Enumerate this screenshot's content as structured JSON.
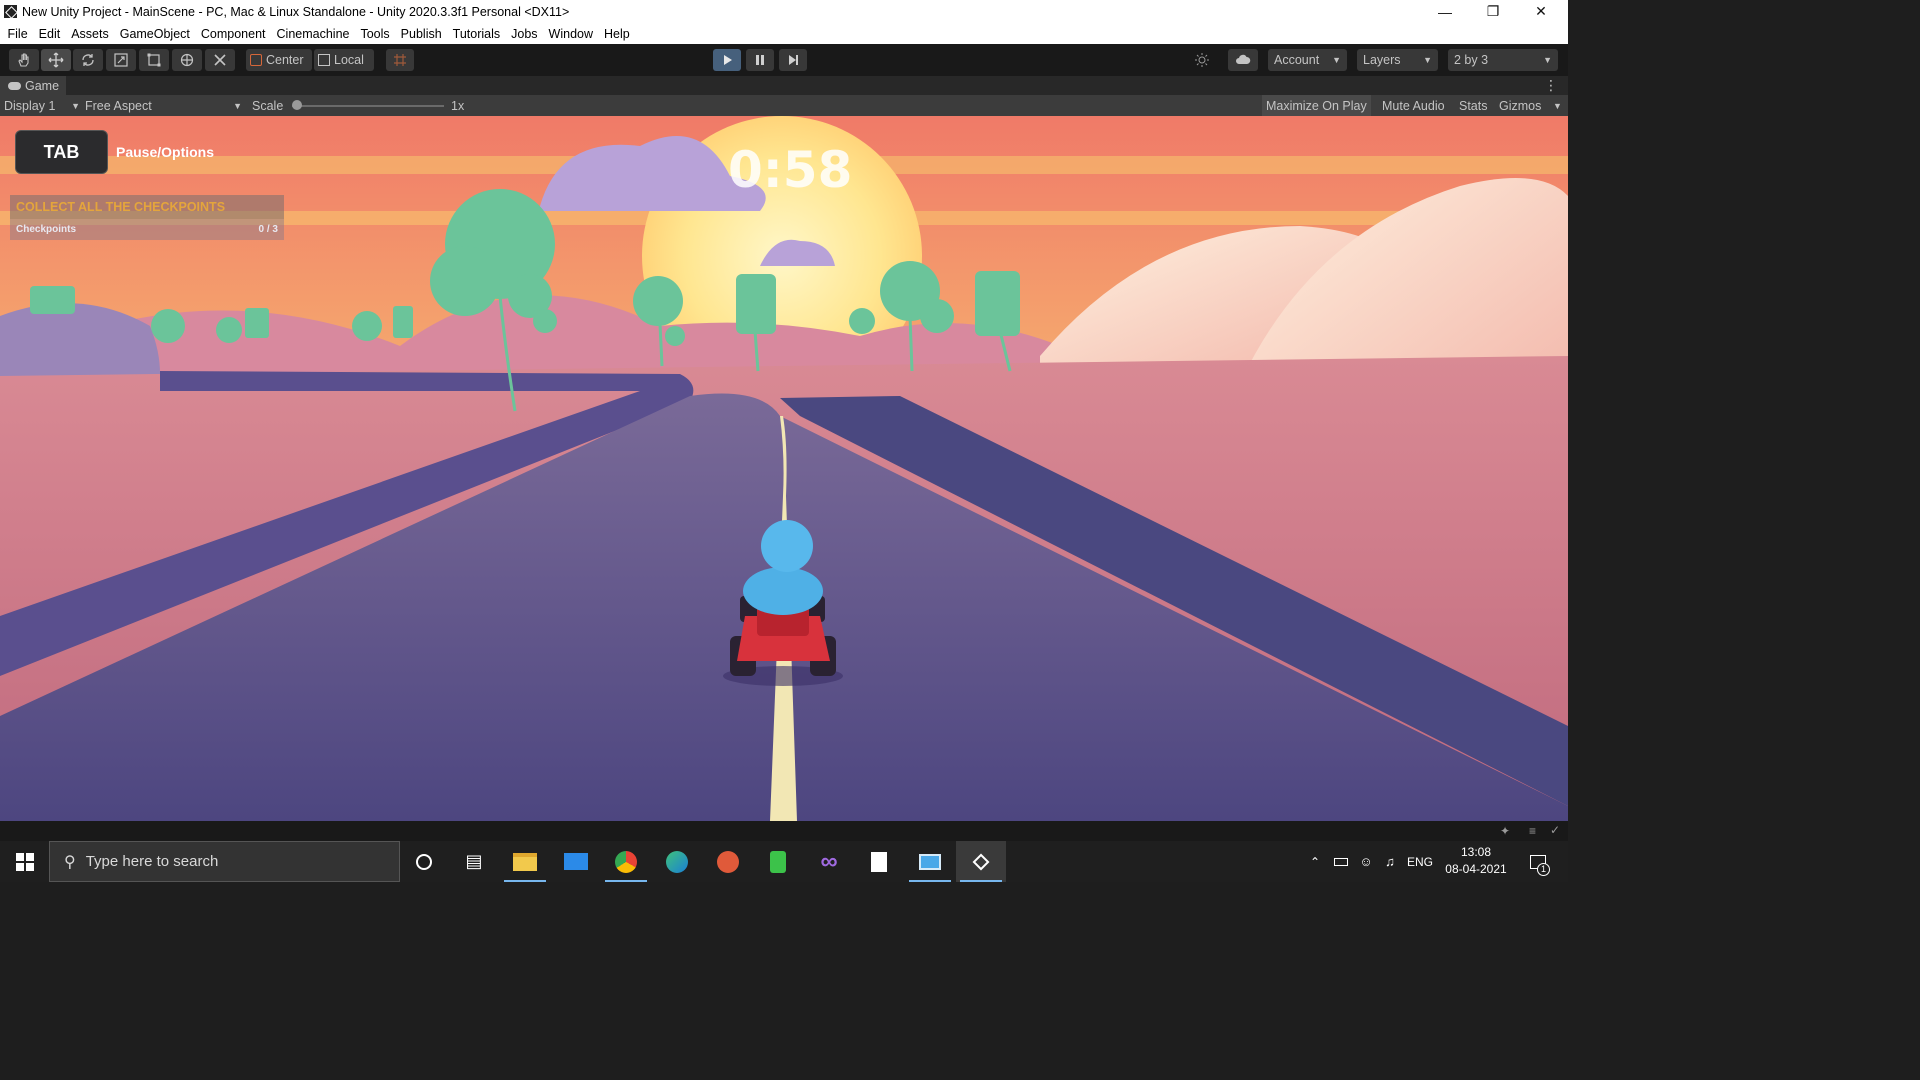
{
  "window": {
    "title": "New Unity Project - MainScene - PC, Mac & Linux Standalone - Unity 2020.3.3f1 Personal <DX11>"
  },
  "menu": [
    "File",
    "Edit",
    "Assets",
    "GameObject",
    "Component",
    "Cinemachine",
    "Tools",
    "Publish",
    "Tutorials",
    "Jobs",
    "Window",
    "Help"
  ],
  "toolbar": {
    "pivot_label": "Center",
    "space_label": "Local",
    "account_label": "Account",
    "layers_label": "Layers",
    "layout_label": "2 by 3"
  },
  "game_view": {
    "tab_label": "Game",
    "display_label": "Display 1",
    "aspect_label": "Free Aspect",
    "scale_label": "Scale",
    "scale_value": "1x",
    "maximize_label": "Maximize On Play",
    "mute_label": "Mute Audio",
    "stats_label": "Stats",
    "gizmos_label": "Gizmos"
  },
  "hud": {
    "tab_key": "TAB",
    "pause_label": "Pause/Options",
    "timer": "0:58",
    "objective": "COLLECT ALL THE CHECKPOINTS",
    "checkpoints_label": "Checkpoints",
    "checkpoints_count": "0 / 3"
  },
  "taskbar": {
    "search_placeholder": "Type here to search",
    "language": "ENG",
    "time": "13:08",
    "date": "08-04-2021",
    "notification_count": "1"
  },
  "colors": {
    "unity_dark": "#191919",
    "play_active": "#46607c",
    "objective_text": "#e4a53c",
    "road": "#4a4880"
  }
}
